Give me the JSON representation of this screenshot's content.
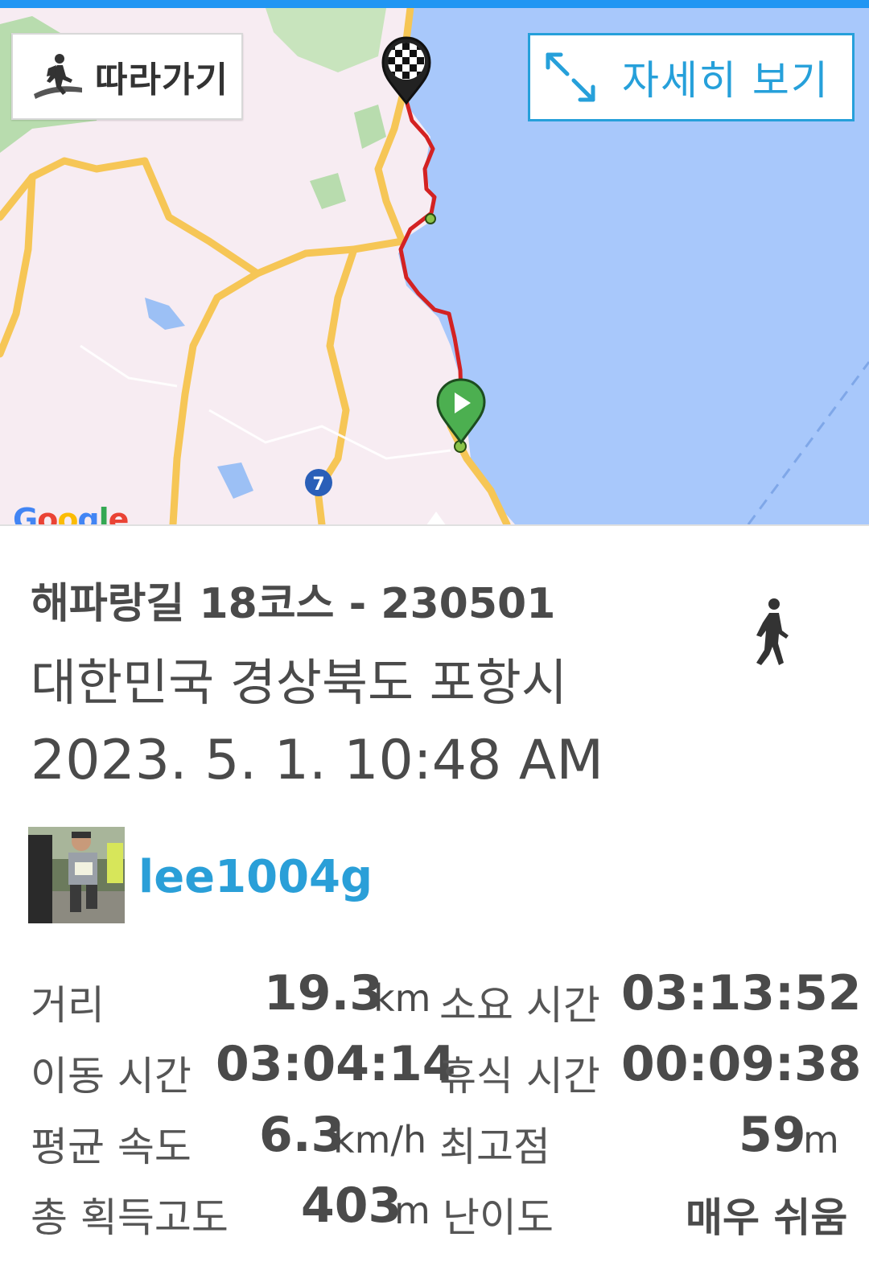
{
  "map": {
    "follow_label": "따라가기",
    "detail_label": "자세히 보기",
    "road_badge": "7",
    "attribution": "Google",
    "attribution_colors": [
      "#4285f4",
      "#ea4335",
      "#fbbc05",
      "#4285f4",
      "#34a853",
      "#ea4335"
    ],
    "colors": {
      "sea": "#a8c8fb",
      "land": "#f7ecf2",
      "route": "#d32222",
      "road": "#f6c656",
      "park": "#b8dcae",
      "water_inland": "#9cc0f5"
    }
  },
  "track": {
    "title": "해파랑길 18코스 - 230501",
    "location": "대한민국 경상북도 포항시",
    "datetime": "2023. 5. 1. 10:48 AM",
    "activity_icon": "walking-icon"
  },
  "user": {
    "name": "lee1004g"
  },
  "stats": {
    "distance_label": "거리",
    "distance_value": "19.3",
    "distance_unit": "km",
    "duration_label": "소요 시간",
    "duration_value": "03:13:52",
    "moving_label": "이동 시간",
    "moving_value": "03:04:14",
    "rest_label": "휴식 시간",
    "rest_value": "00:09:38",
    "avg_speed_label": "평균 속도",
    "avg_speed_value": "6.3",
    "avg_speed_unit": "km/h",
    "max_elev_label": "최고점",
    "max_elev_value": "59",
    "max_elev_unit": "m",
    "gain_label": "총 획득고도",
    "gain_value": "403",
    "gain_unit": "m",
    "difficulty_label": "난이도",
    "difficulty_value": "매우 쉬움"
  }
}
